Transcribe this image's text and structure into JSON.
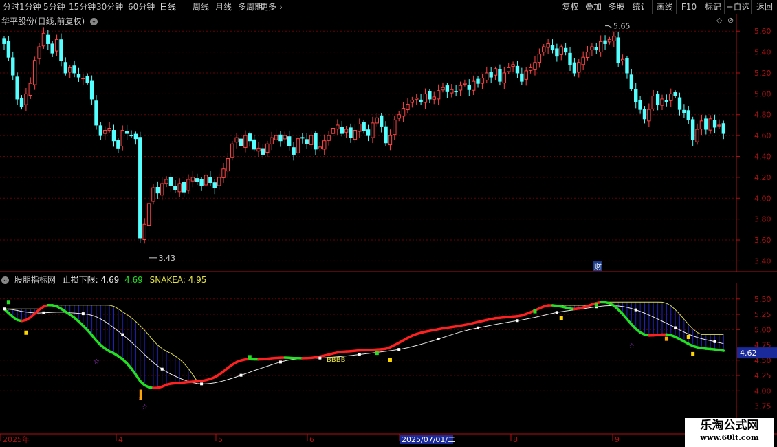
{
  "toolbar": {
    "left_items": [
      "分时",
      "1分钟",
      "5分钟",
      "15分钟",
      "30分钟",
      "60分钟",
      "日线",
      "周线",
      "月线",
      "多周期",
      "更多"
    ],
    "active_item": "日线",
    "right_items": [
      "复权",
      "叠加",
      "多股",
      "统计",
      "画线",
      "F10",
      "标记",
      "+自选",
      "返回"
    ]
  },
  "header": {
    "stock_title": "华平股份(日线,前复权)"
  },
  "main_axis": {
    "ticks": [
      "5.60",
      "5.40",
      "5.20",
      "5.00",
      "4.80",
      "4.60",
      "4.40",
      "4.20",
      "4.00",
      "3.80",
      "3.60",
      "3.40"
    ],
    "ymin": 3.35,
    "ymax": 5.72
  },
  "annotations": {
    "high_label": "5.65",
    "low_label": "3.43",
    "finance_marker": "财"
  },
  "indicator": {
    "name": "股朋指标网",
    "stoploss_label": "止损下限: 4.69",
    "value2": "4.69",
    "snake_label": "SNAKEA: 4.95",
    "ticks": [
      "5.50",
      "5.25",
      "5.00",
      "4.75",
      "4.50",
      "4.25",
      "4.00",
      "3.75"
    ],
    "ymin": 3.7,
    "ymax": 5.7,
    "current_value": "4.62",
    "bbbb_text": "BBBB"
  },
  "date_axis": {
    "labels": [
      "2025年",
      "4",
      "5",
      "6",
      "2025/07/01/二",
      "8",
      "9"
    ]
  },
  "watermark": {
    "title": "乐淘公式网",
    "url": "www.60lt.com"
  },
  "colors": {
    "up": "#ff4444",
    "down": "#54ffff",
    "grid": "#6b0000",
    "axis": "#b01010",
    "snake_green": "#22e022",
    "snake_red": "#ff2020",
    "white_line": "#e8e8e8",
    "cloud_yellow": "#e0e040",
    "cloud_blue": "#2020c0"
  },
  "chart_data": {
    "type": "candlestick",
    "closes": [
      5.48,
      5.35,
      5.18,
      4.95,
      4.88,
      5.0,
      5.1,
      5.32,
      5.45,
      5.58,
      5.48,
      5.39,
      5.52,
      5.32,
      5.2,
      5.25,
      5.2,
      5.16,
      5.15,
      5.11,
      4.95,
      4.7,
      4.6,
      4.65,
      4.67,
      4.55,
      4.48,
      4.65,
      4.62,
      4.6,
      4.57,
      3.62,
      3.75,
      3.95,
      4.1,
      4.05,
      4.14,
      4.18,
      4.12,
      4.08,
      4.14,
      4.06,
      4.18,
      4.2,
      4.16,
      4.12,
      4.22,
      4.15,
      4.1,
      4.2,
      4.28,
      4.38,
      4.52,
      4.58,
      4.5,
      4.6,
      4.55,
      4.47,
      4.48,
      4.42,
      4.52,
      4.58,
      4.6,
      4.55,
      4.6,
      4.5,
      4.42,
      4.57,
      4.58,
      4.52,
      4.6,
      4.47,
      4.49,
      4.55,
      4.6,
      4.67,
      4.7,
      4.62,
      4.66,
      4.58,
      4.65,
      4.71,
      4.65,
      4.6,
      4.72,
      4.77,
      4.69,
      4.53,
      4.6,
      4.75,
      4.8,
      4.86,
      4.9,
      4.94,
      4.96,
      4.92,
      5.0,
      4.95,
      4.97,
      5.03,
      5.06,
      5.02,
      5.04,
      5.02,
      5.08,
      5.1,
      5.04,
      5.12,
      5.1,
      5.15,
      5.2,
      5.16,
      5.24,
      5.12,
      5.2,
      5.25,
      5.28,
      5.2,
      5.12,
      5.22,
      5.25,
      5.3,
      5.38,
      5.45,
      5.48,
      5.42,
      5.36,
      5.45,
      5.4,
      5.28,
      5.2,
      5.3,
      5.35,
      5.4,
      5.45,
      5.42,
      5.5,
      5.48,
      5.52,
      5.55,
      5.3,
      5.33,
      5.2,
      5.05,
      4.92,
      4.85,
      4.76,
      4.85,
      4.98,
      4.9,
      4.95,
      4.92,
      5.0,
      4.98,
      4.85,
      4.82,
      4.75,
      4.56,
      4.66,
      4.74,
      4.66,
      4.76,
      4.68,
      4.7,
      4.62
    ]
  }
}
